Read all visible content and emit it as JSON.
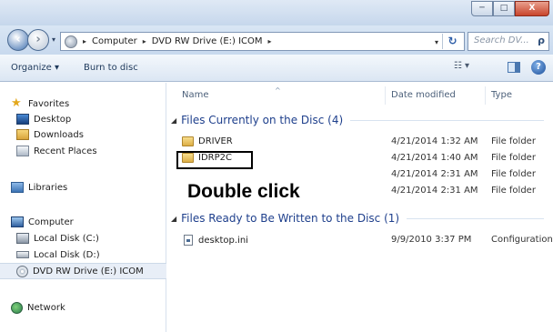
{
  "window": {
    "controls": {
      "minimize": "─",
      "maximize": "□",
      "close": "X"
    }
  },
  "address_bar": {
    "back_icon": "back-arrow-icon",
    "forward_icon": "forward-arrow-icon",
    "dropdown": "▾",
    "breadcrumb": [
      "Computer",
      "DVD RW Drive (E:) ICOM"
    ],
    "separator": "▸",
    "refresh": "↻",
    "search_placeholder": "Search DV...",
    "search_icon": "ρ"
  },
  "toolbar": {
    "organize_label": "Organize ▾",
    "burn_label": "Burn to disc",
    "views_label": "☷ ▾",
    "help_label": "?"
  },
  "sidebar": {
    "favorites": {
      "label": "Favorites",
      "icon": "star-icon"
    },
    "favorites_items": [
      {
        "label": "Desktop",
        "icon": "desktop-icon"
      },
      {
        "label": "Downloads",
        "icon": "downloads-folder-icon"
      },
      {
        "label": "Recent Places",
        "icon": "recent-places-icon"
      }
    ],
    "libraries": {
      "label": "Libraries",
      "icon": "libraries-icon"
    },
    "computer": {
      "label": "Computer",
      "icon": "computer-icon"
    },
    "computer_items": [
      {
        "label": "Local Disk (C:)",
        "icon": "hard-disk-icon"
      },
      {
        "label": "Local Disk (D:)",
        "icon": "hard-disk-icon"
      },
      {
        "label": "DVD RW Drive (E:) ICOM",
        "icon": "dvd-drive-icon",
        "selected": true
      }
    ],
    "network": {
      "label": "Network",
      "icon": "network-icon"
    }
  },
  "columns": {
    "name": "Name",
    "date_modified": "Date modified",
    "type": "Type",
    "sort_indicator": "^"
  },
  "groups": [
    {
      "title": "Files Currently on the Disc (4)",
      "items": [
        {
          "name": "DRIVER",
          "date": "4/21/2014 1:32 AM",
          "type": "File folder",
          "icon": "folder-icon"
        },
        {
          "name": "IDRP2C",
          "date": "4/21/2014 1:40 AM",
          "type": "File folder",
          "icon": "folder-icon"
        },
        {
          "name": "",
          "date": "4/21/2014 2:31 AM",
          "type": "File folder",
          "icon": ""
        },
        {
          "name": "",
          "date": "4/21/2014 2:31 AM",
          "type": "File folder",
          "icon": ""
        }
      ]
    },
    {
      "title": "Files Ready to Be Written to the Disc (1)",
      "items": [
        {
          "name": "desktop.ini",
          "date": "9/9/2010 3:37 PM",
          "type": "Configuration",
          "icon": "ini-file-icon"
        }
      ]
    }
  ],
  "annotation": {
    "callout_text": "Double click"
  }
}
